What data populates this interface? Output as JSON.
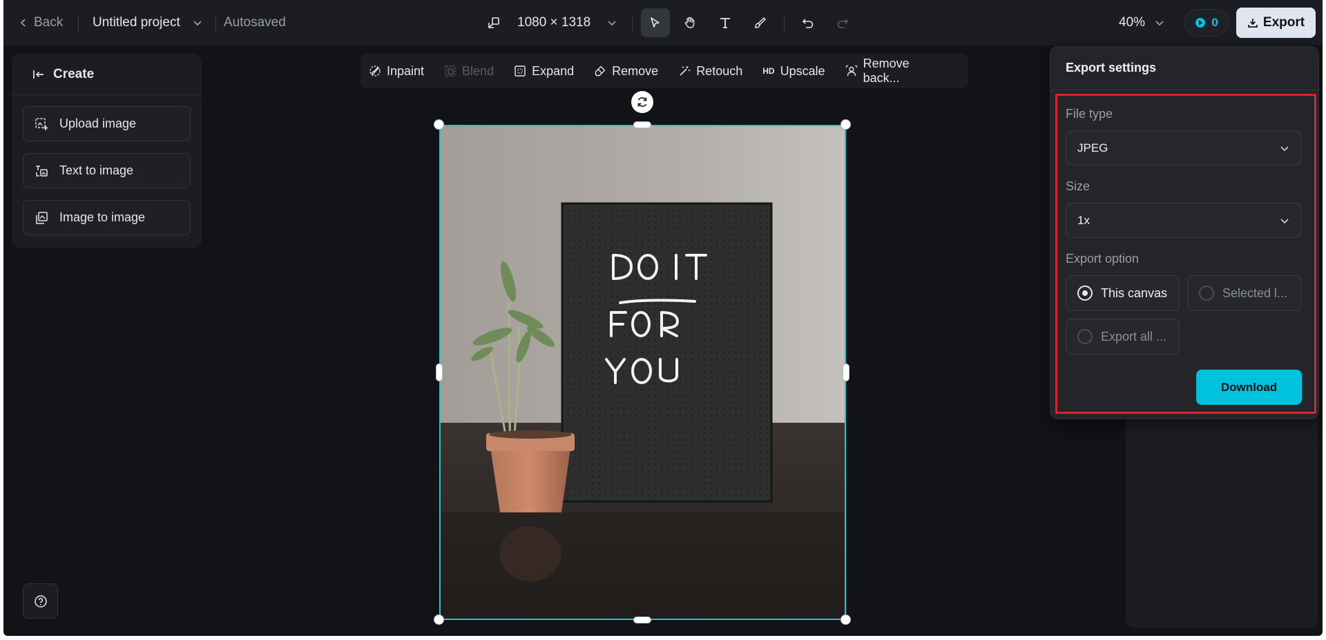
{
  "topbar": {
    "back_label": "Back",
    "project_title": "Untitled project",
    "save_status": "Autosaved",
    "canvas_size": "1080 × 1318",
    "zoom": "40%",
    "credits": "0",
    "export_label": "Export"
  },
  "left_panel": {
    "header": "Create",
    "items": [
      {
        "label": "Upload image",
        "icon": "upload-image-icon"
      },
      {
        "label": "Text to image",
        "icon": "text-to-image-icon"
      },
      {
        "label": "Image to image",
        "icon": "image-to-image-icon"
      }
    ]
  },
  "edit_tools": [
    {
      "label": "Inpaint",
      "icon": "inpaint-icon",
      "disabled": false
    },
    {
      "label": "Blend",
      "icon": "blend-icon",
      "disabled": true
    },
    {
      "label": "Expand",
      "icon": "expand-icon",
      "disabled": false
    },
    {
      "label": "Remove",
      "icon": "eraser-icon",
      "disabled": false
    },
    {
      "label": "Retouch",
      "icon": "retouch-icon",
      "disabled": false
    },
    {
      "label": "Upscale",
      "icon": "hd-icon",
      "disabled": false
    },
    {
      "label": "Remove back...",
      "icon": "remove-background-icon",
      "disabled": false
    }
  ],
  "canvas_image": {
    "board_text": [
      "DO IT",
      "FOR",
      "YOU"
    ]
  },
  "export_settings": {
    "title": "Export settings",
    "file_type_label": "File type",
    "file_type_value": "JPEG",
    "size_label": "Size",
    "size_value": "1x",
    "export_option_label": "Export option",
    "options": [
      {
        "label": "This canvas",
        "selected": true
      },
      {
        "label": "Selected l...",
        "selected": false
      },
      {
        "label": "Export all ...",
        "selected": false
      }
    ],
    "download_label": "Download"
  },
  "colors": {
    "accent": "#00c2dc",
    "selection": "#1fc7cf",
    "highlight": "#e0202d"
  }
}
